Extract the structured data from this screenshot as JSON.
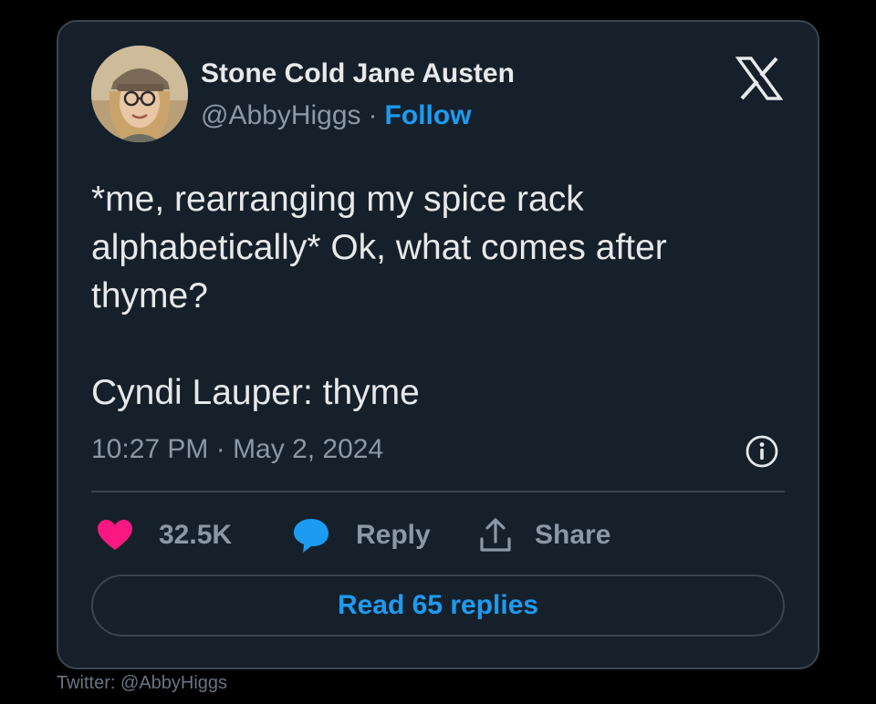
{
  "author": {
    "display_name": "Stone Cold Jane Austen",
    "handle": "@AbbyHiggs",
    "separator": "·",
    "follow_label": "Follow"
  },
  "tweet": {
    "lines": [
      "*me, rearranging my spice rack",
      "alphabetically* Ok, what comes after",
      "thyme?",
      "Cyndi Lauper: thyme"
    ],
    "timestamp": "10:27 PM · May 2, 2024"
  },
  "actions": {
    "like_count": "32.5K",
    "reply_label": "Reply",
    "share_label": "Share"
  },
  "read_replies_label": "Read 65 replies",
  "credit": "Twitter: @AbbyHiggs",
  "colors": {
    "background": "#000000",
    "card": "#15202b",
    "border": "#3a4550",
    "text": "#e7e9ea",
    "muted": "#8b98a5",
    "accent": "#1d9bf0",
    "like": "#f91880"
  },
  "icons": [
    "x-logo-icon",
    "info-icon",
    "heart-icon",
    "reply-bubble-icon",
    "share-icon"
  ]
}
